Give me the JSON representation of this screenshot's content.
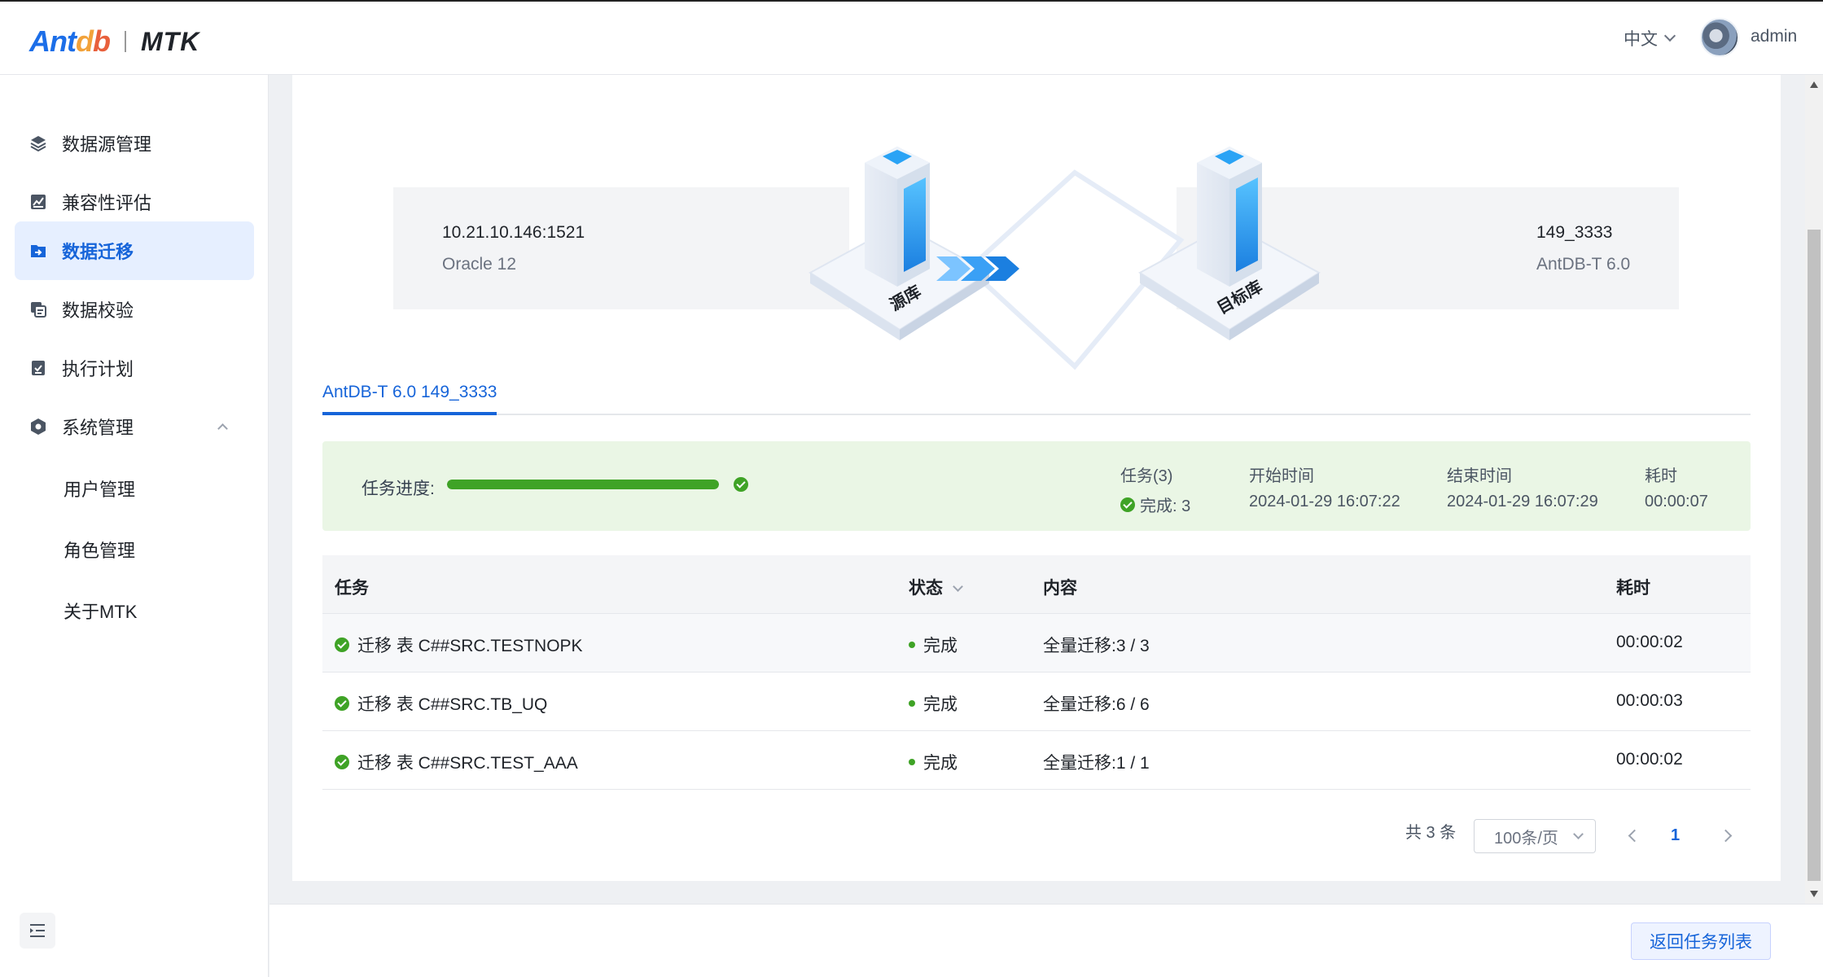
{
  "header": {
    "logo_text": "AntDB",
    "app_name": "MTK",
    "language": "中文",
    "username": "admin"
  },
  "sidebar": {
    "items": [
      {
        "label": "数据源管理",
        "icon": "layers-icon"
      },
      {
        "label": "兼容性评估",
        "icon": "chart-icon"
      },
      {
        "label": "数据迁移",
        "icon": "folder-arrow-icon",
        "active": true
      },
      {
        "label": "数据校验",
        "icon": "copy-icon"
      },
      {
        "label": "执行计划",
        "icon": "checklist-icon"
      },
      {
        "label": "系统管理",
        "icon": "settings-hex-icon",
        "expanded": true
      }
    ],
    "sub_items": [
      "用户管理",
      "角色管理",
      "关于MTK"
    ]
  },
  "source": {
    "host": "10.21.10.146:1521",
    "type": "Oracle 12",
    "label": "源库"
  },
  "target": {
    "host": "149_3333",
    "type": "AntDB-T 6.0",
    "label": "目标库"
  },
  "tab": {
    "label": "AntDB-T 6.0 149_3333"
  },
  "progress": {
    "label": "任务进度:",
    "percent": 100,
    "tasks_label": "任务(3)",
    "done_text": "完成: 3",
    "start_label": "开始时间",
    "start_time": "2024-01-29 16:07:22",
    "end_label": "结束时间",
    "end_time": "2024-01-29 16:07:29",
    "duration_label": "耗时",
    "duration": "00:00:07"
  },
  "table": {
    "headers": {
      "task": "任务",
      "status": "状态",
      "content": "内容",
      "duration": "耗时"
    },
    "rows": [
      {
        "task": "迁移 表 C##SRC.TESTNOPK",
        "status": "完成",
        "content": "全量迁移:3 / 3",
        "duration": "00:00:02"
      },
      {
        "task": "迁移 表 C##SRC.TB_UQ",
        "status": "完成",
        "content": "全量迁移:6 / 6",
        "duration": "00:00:03"
      },
      {
        "task": "迁移 表 C##SRC.TEST_AAA",
        "status": "完成",
        "content": "全量迁移:1 / 1",
        "duration": "00:00:02"
      }
    ]
  },
  "pagination": {
    "total": "共 3 条",
    "page_size": "100条/页",
    "current_page": "1"
  },
  "footer": {
    "back_button": "返回任务列表"
  },
  "colors": {
    "primary": "#1664d9",
    "success": "#3fa326",
    "success_bg": "#eaf6e5"
  }
}
